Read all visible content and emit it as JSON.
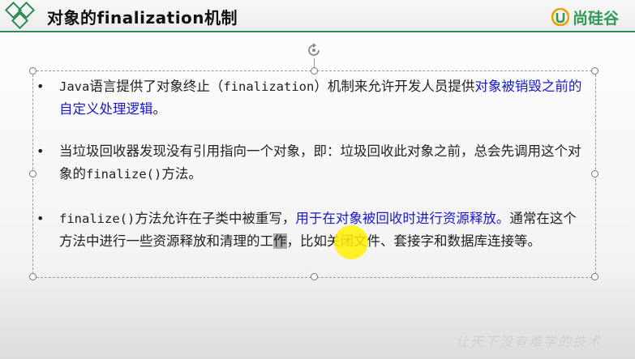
{
  "header": {
    "title": "对象的finalization机制",
    "brand_name": "尚硅谷",
    "colors": {
      "title_rule": "#2e8b57",
      "brand": "#2f9a55"
    },
    "logo_icon": "diamond-squares-icon",
    "brand_icon": "shangguigu-logo-icon"
  },
  "bullets": [
    {
      "parts": [
        {
          "text": "Java",
          "style": "mono"
        },
        {
          "text": "语言提供了对象终止（",
          "style": "plain"
        },
        {
          "text": "finalization",
          "style": "mono"
        },
        {
          "text": "）机制来允许开发人员提供",
          "style": "plain"
        },
        {
          "text": "对象被销毁之前的自定义处理逻辑",
          "style": "emph"
        },
        {
          "text": "。",
          "style": "plain"
        }
      ]
    },
    {
      "parts": [
        {
          "text": "当垃圾回收器发现没有引用指向一个对象，即：垃圾回收此对象之前，总会先调用这个对象的",
          "style": "plain"
        },
        {
          "text": "finalize()",
          "style": "mono"
        },
        {
          "text": "方法。",
          "style": "plain"
        }
      ]
    },
    {
      "parts": [
        {
          "text": "finalize()",
          "style": "mono"
        },
        {
          "text": "方法允许在子类中被重写，",
          "style": "plain"
        },
        {
          "text": "用于在对象被回收时进行资源释放。",
          "style": "emph"
        },
        {
          "text": "通常在这个方法中进行一些资源释放和清理的工",
          "style": "plain"
        },
        {
          "text": "作",
          "style": "highlight"
        },
        {
          "text": "，比如关闭文件、套接字和数据库连接等。",
          "style": "plain"
        }
      ]
    }
  ],
  "bullet_symbol": "•",
  "watermark": "让天下没有难学的技术",
  "colors": {
    "emphasis": "#1a1ac8",
    "cursor": "#fff000"
  }
}
